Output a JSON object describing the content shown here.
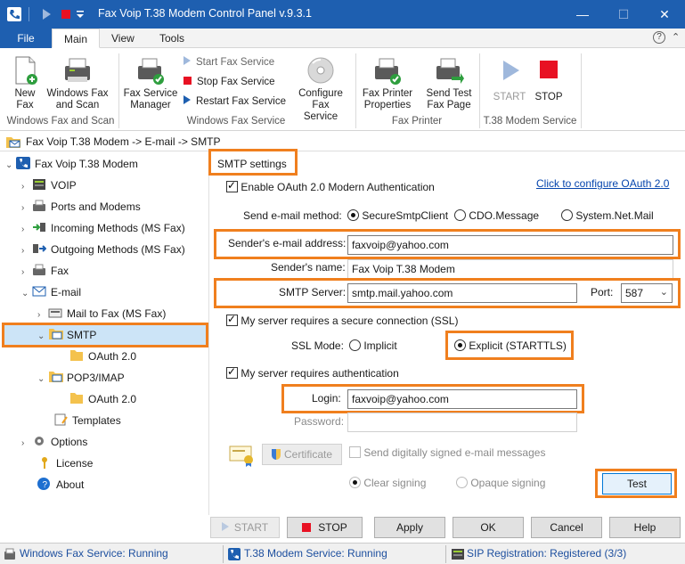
{
  "window": {
    "title": "Fax Voip T.38 Modem Control Panel v.9.3.1",
    "minimize_glyph": "—",
    "maximize_glyph": "☐",
    "close_glyph": "✕"
  },
  "ribbon_tabs": [
    {
      "label": "File"
    },
    {
      "label": "Main"
    },
    {
      "label": "View"
    },
    {
      "label": "Tools"
    }
  ],
  "ribbon_help_glyph": "?",
  "ribbon_collapse_glyph": "⌃",
  "ribbon": {
    "groups": {
      "windows_fax_scan": "Windows Fax and Scan",
      "windows_fax_service": "Windows Fax Service",
      "fax_printer": "Fax Printer",
      "t38_service": "T.38 Modem Service"
    },
    "new_fax": "New\nFax",
    "windows_fax_scan_btn": "Windows Fax\nand Scan",
    "fax_service_manager": "Fax Service\nManager",
    "start_fax_service": "Start Fax Service",
    "stop_fax_service": "Stop Fax Service",
    "restart_fax_service": "Restart Fax Service",
    "configure_fax_service": "Configure\nFax Service",
    "fax_printer_properties": "Fax Printer\nProperties",
    "send_test_fax_page": "Send Test\nFax Page",
    "start": "START",
    "stop": "STOP"
  },
  "breadcrumb": "Fax Voip T.38 Modem -> E-mail -> SMTP",
  "tree": {
    "root": "Fax Voip T.38 Modem",
    "voip": "VOIP",
    "ports": "Ports and Modems",
    "incoming": "Incoming Methods (MS Fax)",
    "outgoing": "Outgoing Methods (MS Fax)",
    "fax": "Fax",
    "email": "E-mail",
    "mail_to_fax": "Mail to Fax (MS Fax)",
    "smtp": "SMTP",
    "oauth1": "OAuth 2.0",
    "pop3": "POP3/IMAP",
    "oauth2": "OAuth 2.0",
    "templates": "Templates",
    "options": "Options",
    "license": "License",
    "about": "About"
  },
  "smtp": {
    "section_title": "SMTP settings",
    "enable_oauth": "Enable OAuth 2.0 Modern Authentication",
    "configure_link": "Click to configure OAuth 2.0",
    "send_method_label": "Send e-mail method:",
    "method_options": [
      "SecureSmtpClient",
      "CDO.Message",
      "System.Net.Mail"
    ],
    "sender_email_label": "Sender's e-mail address:",
    "sender_email_value": "faxvoip@yahoo.com",
    "sender_name_label": "Sender's name:",
    "sender_name_value": "Fax Voip T.38 Modem",
    "smtp_server_label": "SMTP Server:",
    "smtp_server_value": "smtp.mail.yahoo.com",
    "port_label": "Port:",
    "port_value": "587",
    "ssl_check": "My server requires a secure connection (SSL)",
    "ssl_mode_label": "SSL Mode:",
    "ssl_implicit": "Implicit",
    "ssl_explicit": "Explicit (STARTTLS)",
    "auth_check": "My server requires authentication",
    "login_label": "Login:",
    "login_value": "faxvoip@yahoo.com",
    "password_label": "Password:",
    "password_value": "",
    "certificate_btn": "Certificate",
    "signed_check": "Send digitally signed e-mail messages",
    "clear_signing": "Clear signing",
    "opaque_signing": "Opaque signing",
    "test_btn": "Test"
  },
  "bottom_buttons": {
    "start": "START",
    "stop": "STOP",
    "apply": "Apply",
    "ok": "OK",
    "cancel": "Cancel",
    "help": "Help"
  },
  "status": {
    "windows_fax": "Windows Fax Service: Running",
    "t38": "T.38 Modem Service: Running",
    "sip": "SIP Registration: Registered (3/3)"
  },
  "colors": {
    "titlebar": "#1e5fb0",
    "highlight": "#f07f1e",
    "selected_row": "#cce4f7",
    "link": "#0645ad",
    "stop_red": "#e81123"
  }
}
